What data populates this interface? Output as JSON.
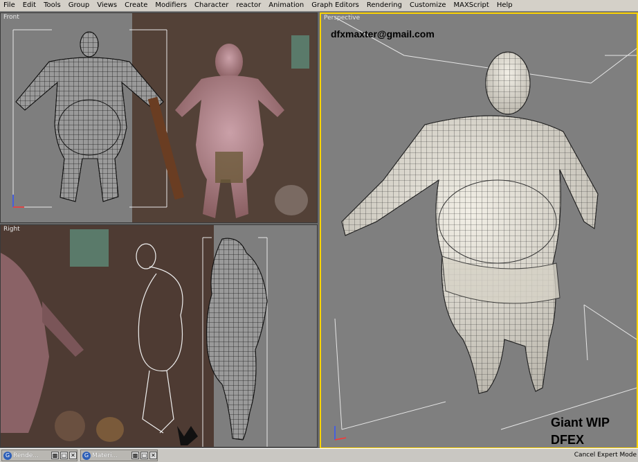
{
  "menu": [
    "File",
    "Edit",
    "Tools",
    "Group",
    "Views",
    "Create",
    "Modifiers",
    "Character",
    "reactor",
    "Animation",
    "Graph Editors",
    "Rendering",
    "Customize",
    "MAXScript",
    "Help"
  ],
  "viewports": {
    "front": {
      "label": "Front"
    },
    "right": {
      "label": "Right"
    },
    "perspective": {
      "label": "Perspective"
    }
  },
  "overlay": {
    "email": "dfxmaxter@gmail.com",
    "title_line1": "Giant WIP",
    "title_line2": "DFEX"
  },
  "taskbar": {
    "tasks": [
      {
        "label": "Rende..."
      },
      {
        "label": "Materi..."
      }
    ],
    "status": "Cancel Expert Mode"
  },
  "colors": {
    "active_viewport": "#ffd400",
    "viewport_bg": "#7f7f7f",
    "menubar": "#d4d0c8"
  }
}
